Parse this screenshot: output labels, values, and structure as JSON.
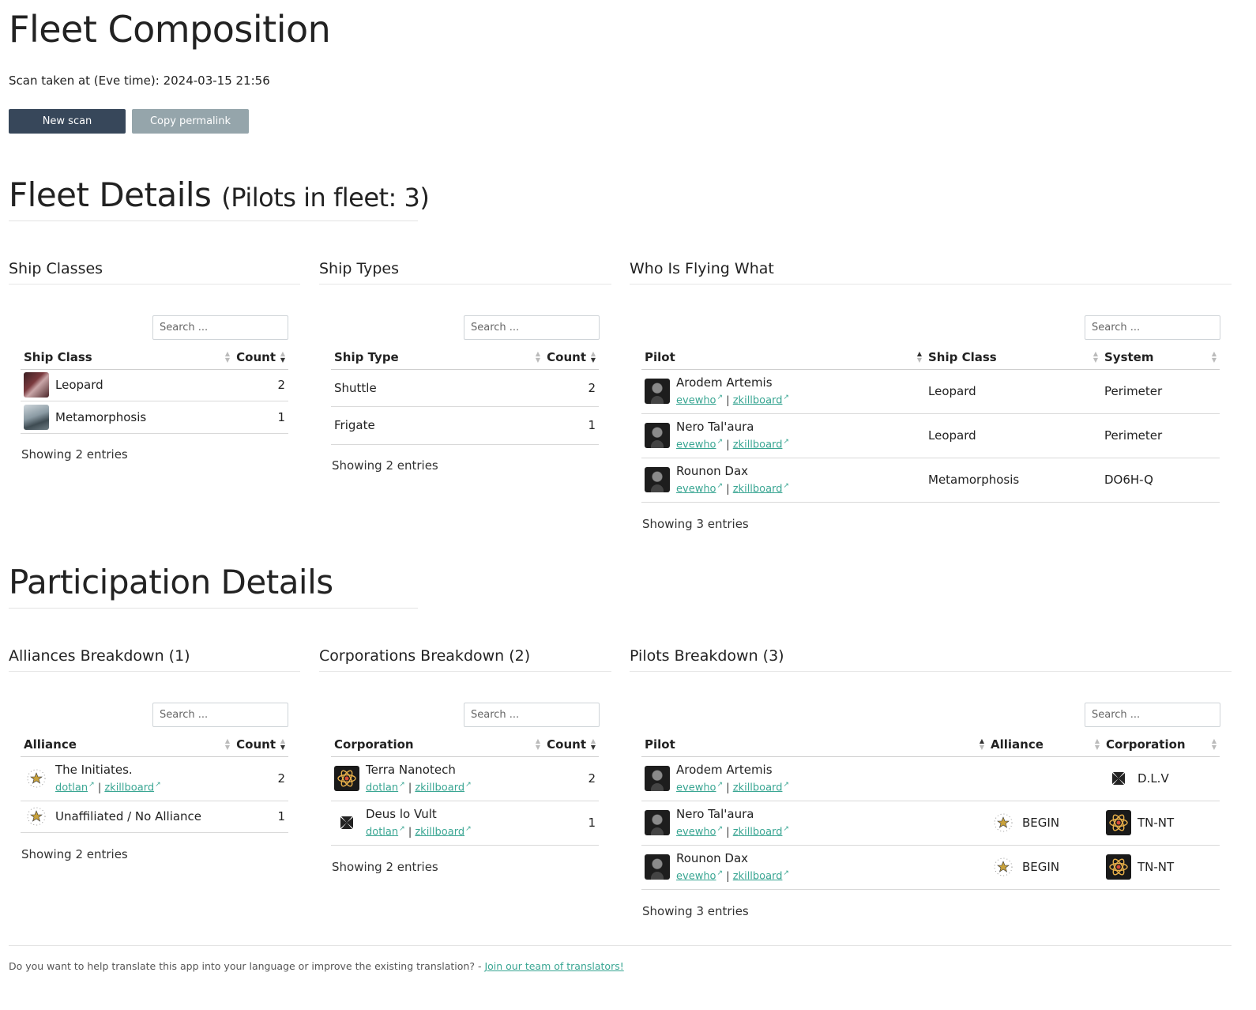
{
  "page_title": "Fleet Composition",
  "scan_info": "Scan taken at (Eve time): 2024-03-15 21:56",
  "buttons": {
    "new_scan": "New scan",
    "copy_permalink": "Copy permalink"
  },
  "fleet_details": {
    "title": "Fleet Details",
    "subtitle": "(Pilots in fleet: 3)"
  },
  "search_placeholder": "Search ...",
  "links": {
    "evewho": "evewho",
    "zkillboard": "zkillboard",
    "dotlan": "dotlan",
    "sep": "|"
  },
  "ship_classes": {
    "title": "Ship Classes",
    "headers": [
      "Ship Class",
      "Count"
    ],
    "rows": [
      {
        "name": "Leopard",
        "count": "2"
      },
      {
        "name": "Metamorphosis",
        "count": "1"
      }
    ],
    "showing": "Showing 2 entries"
  },
  "ship_types": {
    "title": "Ship Types",
    "headers": [
      "Ship Type",
      "Count"
    ],
    "rows": [
      {
        "name": "Shuttle",
        "count": "2"
      },
      {
        "name": "Frigate",
        "count": "1"
      }
    ],
    "showing": "Showing 2 entries"
  },
  "who_flying": {
    "title": "Who Is Flying What",
    "headers": [
      "Pilot",
      "Ship Class",
      "System"
    ],
    "rows": [
      {
        "pilot": "Arodem Artemis",
        "ship_class": "Leopard",
        "system": "Perimeter"
      },
      {
        "pilot": "Nero Tal'aura",
        "ship_class": "Leopard",
        "system": "Perimeter"
      },
      {
        "pilot": "Rounon Dax",
        "ship_class": "Metamorphosis",
        "system": "DO6H-Q"
      }
    ],
    "showing": "Showing 3 entries"
  },
  "participation": {
    "title": "Participation Details"
  },
  "alliances": {
    "title": "Alliances Breakdown (1)",
    "headers": [
      "Alliance",
      "Count"
    ],
    "rows": [
      {
        "name": "The Initiates.",
        "count": "2",
        "has_links": true
      },
      {
        "name": "Unaffiliated / No Alliance",
        "count": "1",
        "has_links": false
      }
    ],
    "showing": "Showing 2 entries"
  },
  "corporations": {
    "title": "Corporations Breakdown (2)",
    "headers": [
      "Corporation",
      "Count"
    ],
    "rows": [
      {
        "name": "Terra Nanotech",
        "count": "2"
      },
      {
        "name": "Deus lo Vult",
        "count": "1"
      }
    ],
    "showing": "Showing 2 entries"
  },
  "pilots": {
    "title": "Pilots Breakdown (3)",
    "headers": [
      "Pilot",
      "Alliance",
      "Corporation"
    ],
    "rows": [
      {
        "pilot": "Arodem Artemis",
        "alliance": "",
        "corporation": "D.L.V"
      },
      {
        "pilot": "Nero Tal'aura",
        "alliance": "BEGIN",
        "corporation": "TN-NT"
      },
      {
        "pilot": "Rounon Dax",
        "alliance": "BEGIN",
        "corporation": "TN-NT"
      }
    ],
    "showing": "Showing 3 entries"
  },
  "footer": {
    "text": "Do you want to help translate this app into your language or improve the existing translation? - ",
    "link": "Join our team of translators!"
  },
  "colors": {
    "primary_button": "#37475a",
    "secondary_button": "#95a5ab",
    "link": "#3aa693"
  }
}
